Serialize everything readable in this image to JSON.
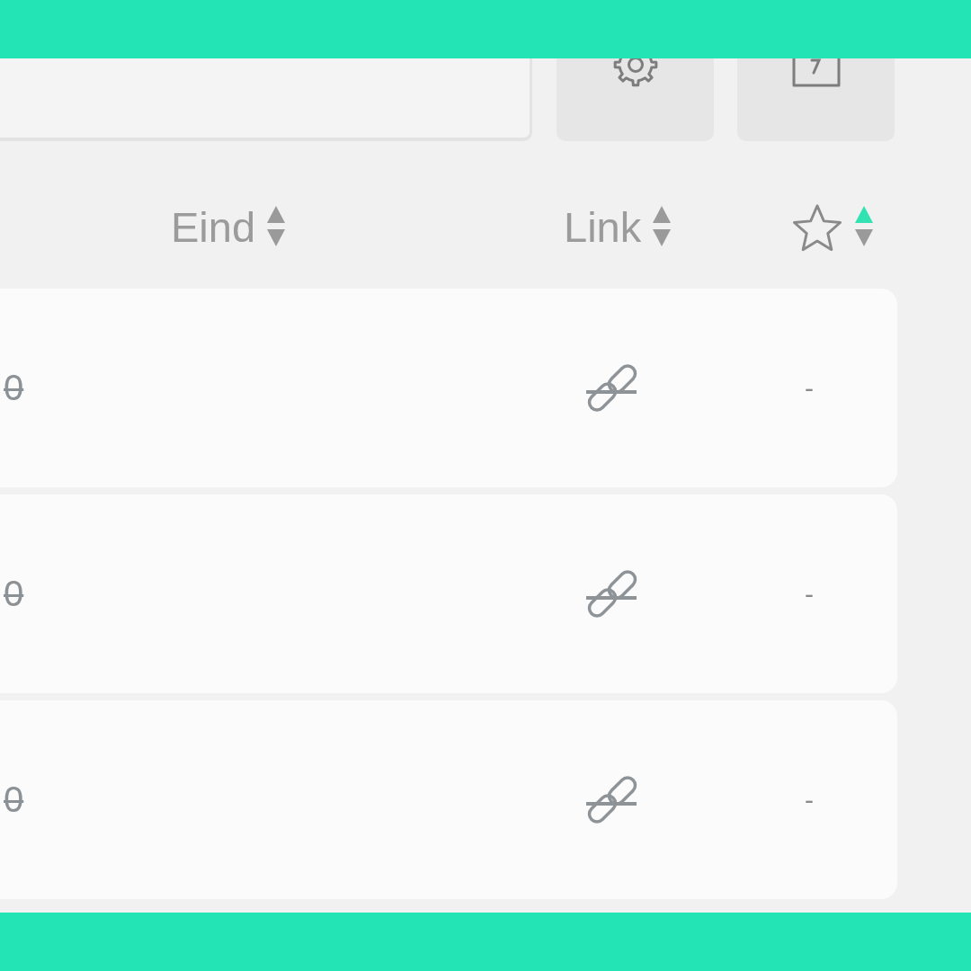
{
  "toolbar": {
    "buttons": [
      {
        "kind": "gear"
      },
      {
        "kind": "square"
      }
    ]
  },
  "columns": [
    {
      "kind": "text",
      "label": "Eind",
      "sorted_ascending": false
    },
    {
      "kind": "text",
      "label": "Link",
      "sorted_ascending": false
    },
    {
      "kind": "star",
      "sorted_ascending": true
    }
  ],
  "rows": [
    {
      "column_1": "0",
      "column_1_struck": true,
      "link_struck": true,
      "star": "-"
    },
    {
      "column_1": "0",
      "column_1_struck": true,
      "link_struck": true,
      "star": "-"
    },
    {
      "column_1": "0",
      "column_1_struck": true,
      "link_struck": true,
      "star": "-"
    }
  ]
}
